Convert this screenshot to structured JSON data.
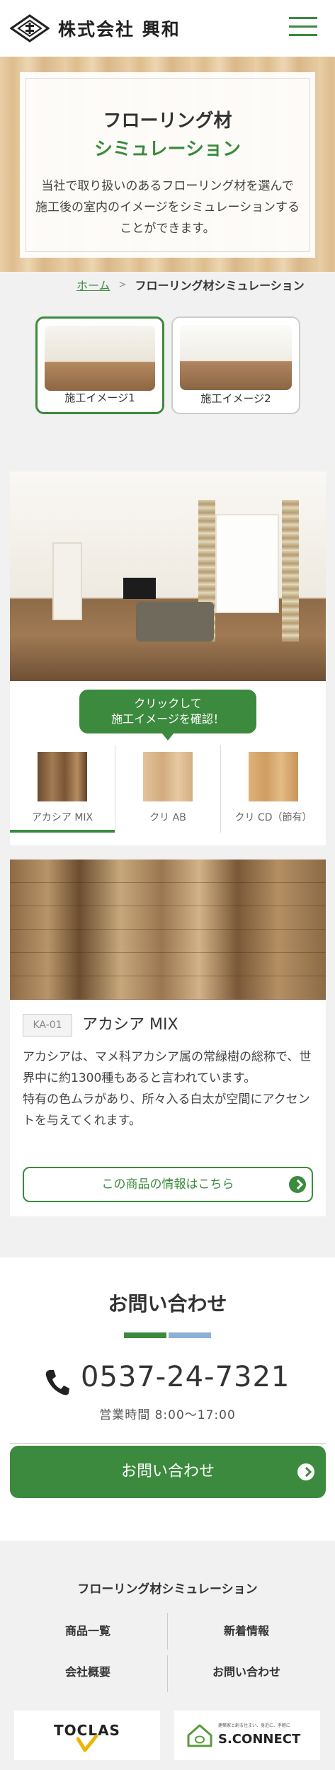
{
  "header": {
    "logo_text": "株式会社 興和",
    "menu_icon": "hamburger-menu-icon"
  },
  "hero": {
    "title_line1": "フローリング材",
    "title_line2": "シミュレーション",
    "description": "当社で取り扱いのあるフローリング材を選んで 施工後の室内のイメージをシミュレーションすることができます。"
  },
  "breadcrumb": {
    "home": "ホーム",
    "separator": ">",
    "current": "フローリング材シミュレーション"
  },
  "scenes": [
    {
      "label": "施工イメージ1",
      "selected": true
    },
    {
      "label": "施工イメージ2",
      "selected": false
    }
  ],
  "switcher": {
    "bubble_line1": "クリックして",
    "bubble_line2": "施工イメージを確認！",
    "swatches": [
      {
        "label": "アカシア MIX",
        "color": "#8a6240",
        "selected": true
      },
      {
        "label": "クリ AB",
        "color": "#d9b489",
        "selected": false
      },
      {
        "label": "クリ CD（節有）",
        "color": "#d8ad76",
        "selected": false
      }
    ]
  },
  "product": {
    "code": "KA-01",
    "name": "アカシア MIX",
    "desc_line1": "アカシアは、マメ科アカシア属の常緑樹の総称で、世界中に約1300種もあると言われています。",
    "desc_line2": "特有の色ムラがあり、所々入る白太が空間にアクセントを与えてくれます。",
    "button_label": "この商品の情報はこちら"
  },
  "contact": {
    "title": "お問い合わせ",
    "phone": "0537-24-7321",
    "hours": "営業時間 8:00～17:00",
    "button_label": "お問い合わせ"
  },
  "footer": {
    "title": "フローリング材シミュレーション",
    "links": [
      "商品一覧",
      "新着情報",
      "会社概要",
      "お問い合わせ"
    ],
    "banner1": "TOCLAS",
    "banner2": "S.CONNECT",
    "banner2_tagline1": "建築家と創る住まい、身近に、手軽に",
    "banner2_tagline2": ""
  },
  "colors": {
    "accent": "#3c8a3d",
    "accent_blue": "#8fb0d5"
  }
}
